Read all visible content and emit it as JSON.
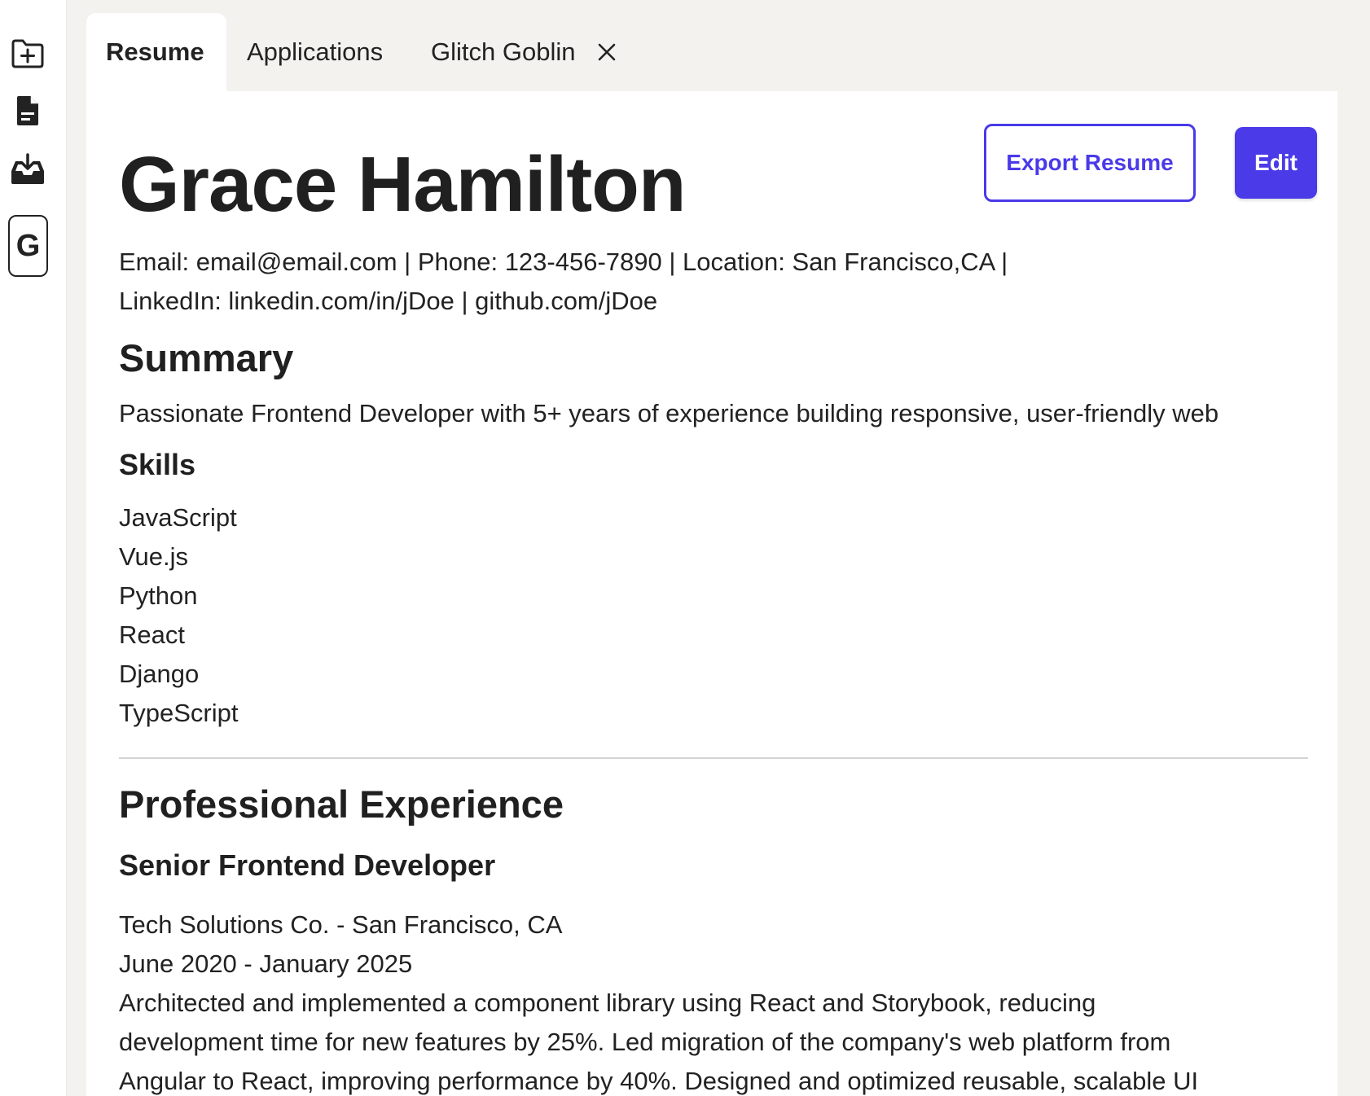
{
  "rail": {
    "icons": [
      "folder-plus-icon",
      "document-icon",
      "inbox-download-icon"
    ],
    "profile_letter": "G"
  },
  "tabs": [
    {
      "label": "Resume",
      "active": true
    },
    {
      "label": "Applications",
      "active": false
    },
    {
      "label": "Glitch Goblin",
      "active": false,
      "closable": true
    }
  ],
  "resume": {
    "name": "Grace Hamilton",
    "export_label": "Export Resume",
    "edit_label": "Edit",
    "contact_line1": "Email: email@email.com | Phone: 123-456-7890 | Location: San Francisco,CA |",
    "contact_line2": "LinkedIn: linkedin.com/in/jDoe | github.com/jDoe",
    "summary_heading": "Summary",
    "summary_text": "Passionate Frontend Developer with 5+ years of experience building responsive, user-friendly web",
    "skills_heading": "Skills",
    "skills": [
      "JavaScript",
      "Vue.js",
      "Python",
      "React",
      "Django",
      "TypeScript"
    ],
    "experience_heading": "Professional Experience",
    "job": {
      "title": "Senior Frontend Developer",
      "company": "Tech Solutions Co. - San Francisco, CA",
      "dates": "June 2020 - January 2025",
      "desc_line1": "Architected and implemented a component library using React and Storybook, reducing",
      "desc_line2": "development time for new features by 25%. Led migration of the company's web platform from",
      "desc_line3": "Angular to React, improving performance by 40%. Designed and optimized reusable, scalable UI"
    }
  },
  "colors": {
    "accent": "#4a3ae8",
    "background": "#f3f2ef",
    "panel": "#ffffff",
    "text": "#222222"
  }
}
